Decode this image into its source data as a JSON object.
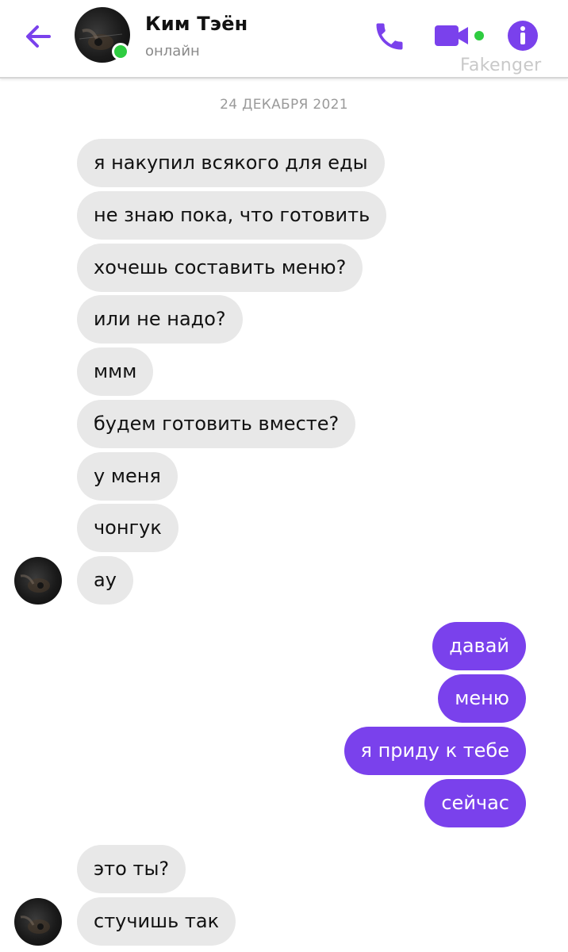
{
  "header": {
    "contact_name": "Ким Тэён",
    "status": "онлайн",
    "watermark": "Fakenger",
    "icons": {
      "back": "arrow-left-icon",
      "call": "phone-icon",
      "video": "video-camera-icon",
      "info": "info-icon"
    }
  },
  "colors": {
    "accent": "#7a41ec",
    "online": "#2ecc40",
    "incoming_bubble": "#e8e8e8",
    "outgoing_bubble": "#7a41ec"
  },
  "date_separator": "24 ДЕКАБРЯ 2021",
  "messages": [
    {
      "direction": "in",
      "text": "я накупил всякого для еды"
    },
    {
      "direction": "in",
      "text": "не знаю пока, что готовить"
    },
    {
      "direction": "in",
      "text": "хочешь составить меню?"
    },
    {
      "direction": "in",
      "text": "или не надо?"
    },
    {
      "direction": "in",
      "text": "ммм"
    },
    {
      "direction": "in",
      "text": "будем готовить вместе?"
    },
    {
      "direction": "in",
      "text": "у меня"
    },
    {
      "direction": "in",
      "text": "чонгук"
    },
    {
      "direction": "in",
      "text": "ау"
    },
    {
      "direction": "out",
      "text": "давай"
    },
    {
      "direction": "out",
      "text": "меню"
    },
    {
      "direction": "out",
      "text": "я приду к тебе"
    },
    {
      "direction": "out",
      "text": "сейчас"
    },
    {
      "direction": "in",
      "text": "это ты?"
    },
    {
      "direction": "in",
      "text": "стучишь так"
    }
  ]
}
